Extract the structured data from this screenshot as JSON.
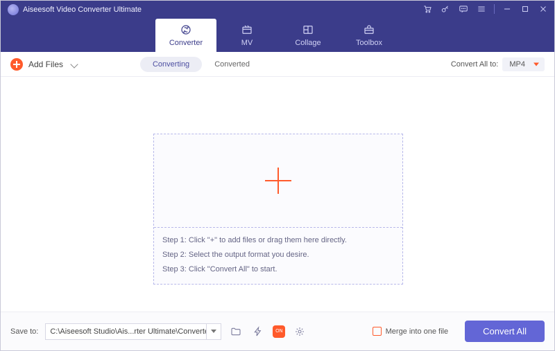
{
  "title": "Aiseesoft Video Converter Ultimate",
  "tabs": [
    "Converter",
    "MV",
    "Collage",
    "Toolbox"
  ],
  "toolbar": {
    "add_files": "Add Files",
    "seg_converting": "Converting",
    "seg_converted": "Converted",
    "convert_all_to_label": "Convert All to:",
    "convert_all_to_value": "MP4"
  },
  "drop": {
    "step1": "Step 1: Click \"+\" to add files or drag them here directly.",
    "step2": "Step 2: Select the output format you desire.",
    "step3": "Step 3: Click \"Convert All\" to start."
  },
  "footer": {
    "save_to_label": "Save to:",
    "path": "C:\\Aiseesoft Studio\\Ais...rter Ultimate\\Converted",
    "merge_label": "Merge into one file",
    "gpu_badge": "ON",
    "convert_all": "Convert All"
  }
}
